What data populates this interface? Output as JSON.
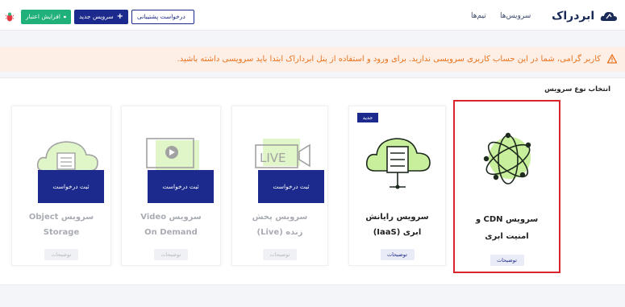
{
  "header": {
    "logo_text": "ابردراک",
    "nav": {
      "services": "سرویس‌ها",
      "teams": "تیم‌ها"
    },
    "buttons": {
      "support": "درخواست پشتیبانی",
      "new_service": "سرویس جدید",
      "increase_credit": "افزایش اعتبار"
    }
  },
  "alert": {
    "text": "کاربر گرامی، شما در این حساب کاربری سرویسی ندارید. برای ورود و استفاده از پنل ابرداراک ابتدا باید سرویسی داشته باشید."
  },
  "panel": {
    "title": "انتخاب نوع سرویس"
  },
  "cards": [
    {
      "line1": "سرویس CDN و",
      "line2": "امنیت ابری",
      "desc": "توضیحات",
      "state": "selected"
    },
    {
      "line1": "سرویس رایانش",
      "line2": "ابری (IaaS)",
      "desc": "توضیحات",
      "badge": "جدید"
    },
    {
      "line1": "سرویس پخش",
      "line2": "زنده (Live)",
      "desc": "توضیحات",
      "register": "ثبت درخواست",
      "state": "disabled",
      "art_text": "LIVE"
    },
    {
      "line1": "سرویس Video",
      "line2": "On Demand",
      "desc": "توضیحات",
      "register": "ثبت درخواست",
      "state": "disabled"
    },
    {
      "line1": "سرویس Object",
      "line2": "Storage",
      "desc": "توضیحات",
      "register": "ثبت درخواست",
      "state": "disabled"
    }
  ],
  "colors": {
    "primary": "#1b2a8c",
    "success": "#20b07a",
    "warning_bg": "#fdeee6",
    "warning_text": "#e8741f",
    "highlight_border": "#d9262c",
    "illustration_green": "#c8ef9c"
  }
}
